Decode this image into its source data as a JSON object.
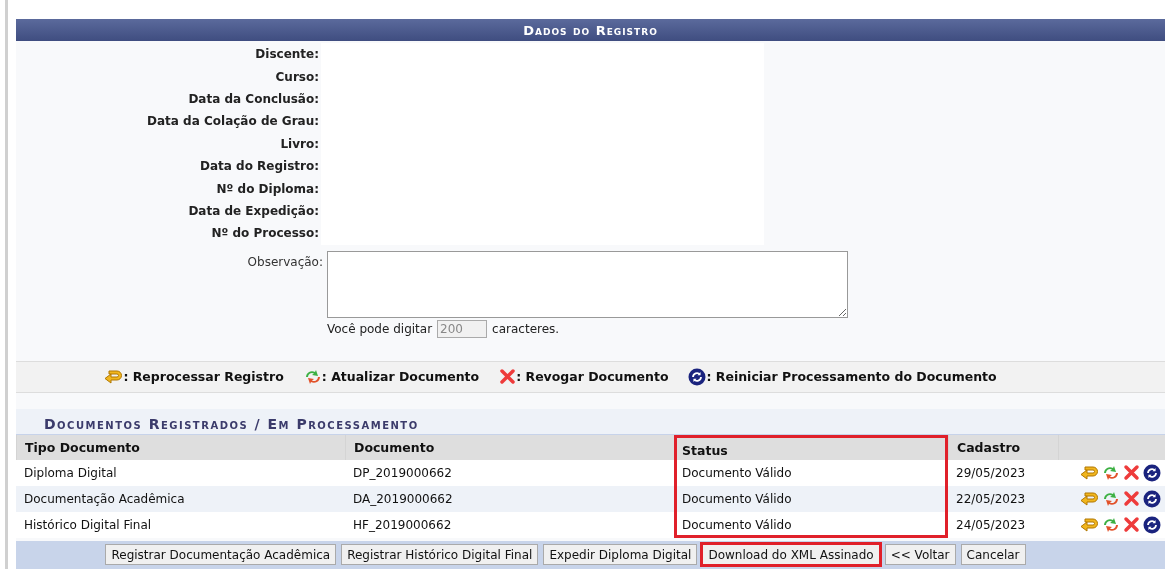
{
  "panel": {
    "title": "Dados do Registro"
  },
  "fields": [
    {
      "label": "Discente:"
    },
    {
      "label": "Curso:"
    },
    {
      "label": "Data da Conclusão:"
    },
    {
      "label": "Data da Colação de Grau:"
    },
    {
      "label": "Livro:"
    },
    {
      "label": "Data do Registro:"
    },
    {
      "label": "Nº do Diploma:"
    },
    {
      "label": "Data de Expedição:"
    },
    {
      "label": "Nº do Processo:"
    }
  ],
  "observation": {
    "label": "Observação:",
    "counter_prefix": "Você pode digitar",
    "counter_value": "200",
    "counter_suffix": "caracteres."
  },
  "legend": [
    {
      "kind": "reprocess",
      "label": ": Reprocessar Registro"
    },
    {
      "kind": "update",
      "label": ": Atualizar Documento"
    },
    {
      "kind": "revoke",
      "label": ": Revogar Documento"
    },
    {
      "kind": "restart",
      "label": ": Reiniciar Processamento do Documento"
    }
  ],
  "documents": {
    "title": "Documentos Registrados / Em Processamento",
    "columns": [
      {
        "label": "Tipo Documento",
        "highlighted": false
      },
      {
        "label": "Documento",
        "highlighted": false
      },
      {
        "label": "Status",
        "highlighted": true
      },
      {
        "label": "Cadastro",
        "highlighted": false
      }
    ],
    "rows": [
      {
        "cells": [
          "Diploma Digital",
          "DP_2019000662",
          "Documento Válido",
          "29/05/2023"
        ]
      },
      {
        "cells": [
          "Documentação Acadêmica",
          "DA_2019000662",
          "Documento Válido",
          "22/05/2023"
        ]
      },
      {
        "cells": [
          "Histórico Digital Final",
          "HF_2019000662",
          "Documento Válido",
          "24/05/2023"
        ]
      }
    ]
  },
  "buttons": [
    {
      "label": "Registrar Documentação Acadêmica",
      "highlighted": false
    },
    {
      "label": "Registrar Histórico Digital Final",
      "highlighted": false
    },
    {
      "label": "Expedir Diploma Digital",
      "highlighted": false
    },
    {
      "label": "Download do XML Assinado",
      "highlighted": true
    },
    {
      "label": "<< Voltar",
      "highlighted": false
    },
    {
      "label": "Cancelar",
      "highlighted": false
    }
  ]
}
